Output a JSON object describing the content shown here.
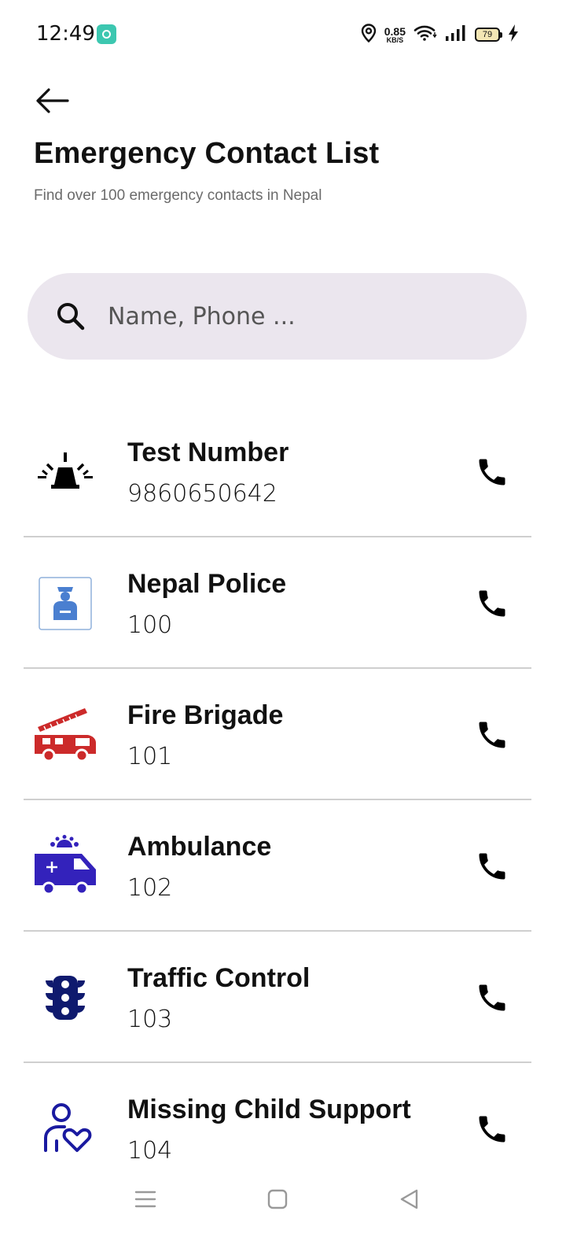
{
  "status_bar": {
    "time": "12:49",
    "net_speed_value": "0.85",
    "net_speed_unit": "KB/S",
    "battery_level": "79",
    "icons": [
      "app-notification-icon",
      "location-icon",
      "wifi-icon",
      "signal-icon",
      "battery-icon",
      "charging-icon"
    ]
  },
  "header": {
    "back_icon": "arrow-left-icon",
    "title": "Emergency Contact List",
    "subtitle": "Find over 100 emergency contacts in Nepal"
  },
  "search": {
    "placeholder": "Name, Phone ...",
    "value": "",
    "icon": "search-icon"
  },
  "contacts": [
    {
      "name": "Test Number",
      "number": "9860650642",
      "icon": "siren-icon",
      "icon_color": "#000000"
    },
    {
      "name": "Nepal Police",
      "number": "100",
      "icon": "police-icon",
      "icon_color": "#4a7fd0"
    },
    {
      "name": "Fire Brigade",
      "number": "101",
      "icon": "fire-truck-icon",
      "icon_color": "#cc2a2a"
    },
    {
      "name": "Ambulance",
      "number": "102",
      "icon": "ambulance-icon",
      "icon_color": "#3322bb"
    },
    {
      "name": "Traffic Control",
      "number": "103",
      "icon": "traffic-light-icon",
      "icon_color": "#0f1a6e"
    },
    {
      "name": "Missing Child Support",
      "number": "104",
      "icon": "child-support-icon",
      "icon_color": "#1a1aa0"
    }
  ],
  "call_icon": "phone-icon",
  "nav_bar": {
    "items": [
      "menu-icon",
      "home-square-icon",
      "back-triangle-icon"
    ]
  }
}
